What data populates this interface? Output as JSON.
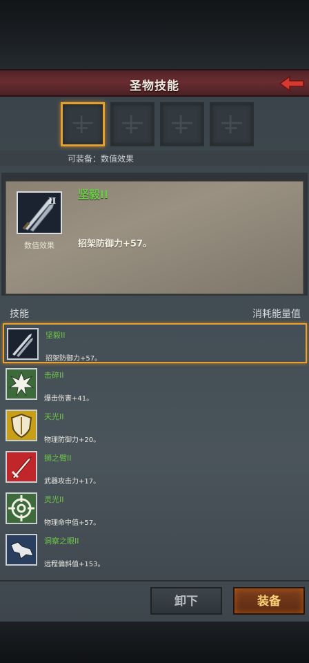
{
  "header": {
    "title": "圣物技能"
  },
  "slots": {
    "count": 4,
    "equip_hint": "可装备：数值效果"
  },
  "detail": {
    "name": "坚毅II",
    "category": "数值效果",
    "effect": "招架防御力+57。",
    "level_badge": "II"
  },
  "list_header": {
    "skills_label": "技能",
    "cost_label": "消耗能量值"
  },
  "skills": [
    {
      "name": "坚毅II",
      "effect": "招架防御力+57。",
      "icon": "crossed-swords-icon"
    },
    {
      "name": "击碎II",
      "effect": "爆击伤害+41。",
      "icon": "burst-icon"
    },
    {
      "name": "天光II",
      "effect": "物理防御力+20。",
      "icon": "shield-icon"
    },
    {
      "name": "狮之臂II",
      "effect": "武器攻击力+17。",
      "icon": "sword-icon"
    },
    {
      "name": "灵光II",
      "effect": "物理命中值+57。",
      "icon": "crosshair-icon"
    },
    {
      "name": "洞察之眼II",
      "effect": "远程偏斜值+153。",
      "icon": "wolf-icon"
    }
  ],
  "buttons": {
    "unequip": "卸下",
    "equip": "装备"
  },
  "colors": {
    "accent": "#e4a030",
    "skill_name": "#6ec84a",
    "header": "#6a2c30"
  }
}
